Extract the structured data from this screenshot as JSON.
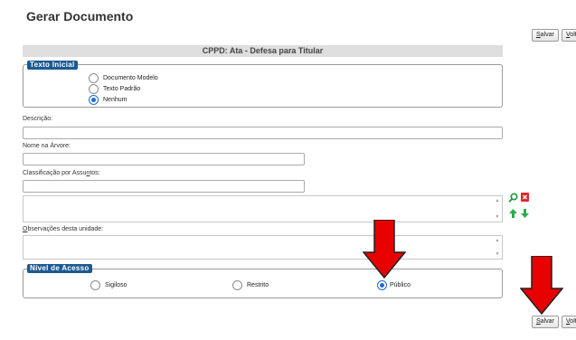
{
  "page": {
    "title": "Gerar Documento"
  },
  "toolbar": {
    "save_label": "Salvar",
    "back_label": "Volt"
  },
  "document": {
    "type_label": "CPPD: Ata - Defesa para Titular"
  },
  "texto_inicial": {
    "legend": "Texto Inicial",
    "options": [
      "Documento Modelo",
      "Texto Padrão",
      "Nenhum"
    ],
    "selected": "Nenhum"
  },
  "fields": {
    "descricao_label": "Descrição:",
    "descricao_value": "",
    "nome_arvore_label": "Nome na Árvore:",
    "nome_arvore_value": "",
    "classificacao_label_pre": "Classificação por Assu",
    "classificacao_label_u": "n",
    "classificacao_label_post": "tos:",
    "classificacao_value": "",
    "observacoes_label_u": "O",
    "observacoes_label_rest": "bservações desta unidade:"
  },
  "nivel_acesso": {
    "legend": "Nível de Acesso",
    "options": [
      "Sigiloso",
      "Restrito",
      "Público"
    ],
    "selected": "Público"
  },
  "colors": {
    "legend_bg": "#1b5a92",
    "arrow_red": "#e60000",
    "radio_blue": "#1c6fd3"
  },
  "icons": [
    "search-icon",
    "remove-icon",
    "move-up-icon",
    "move-down-icon"
  ]
}
